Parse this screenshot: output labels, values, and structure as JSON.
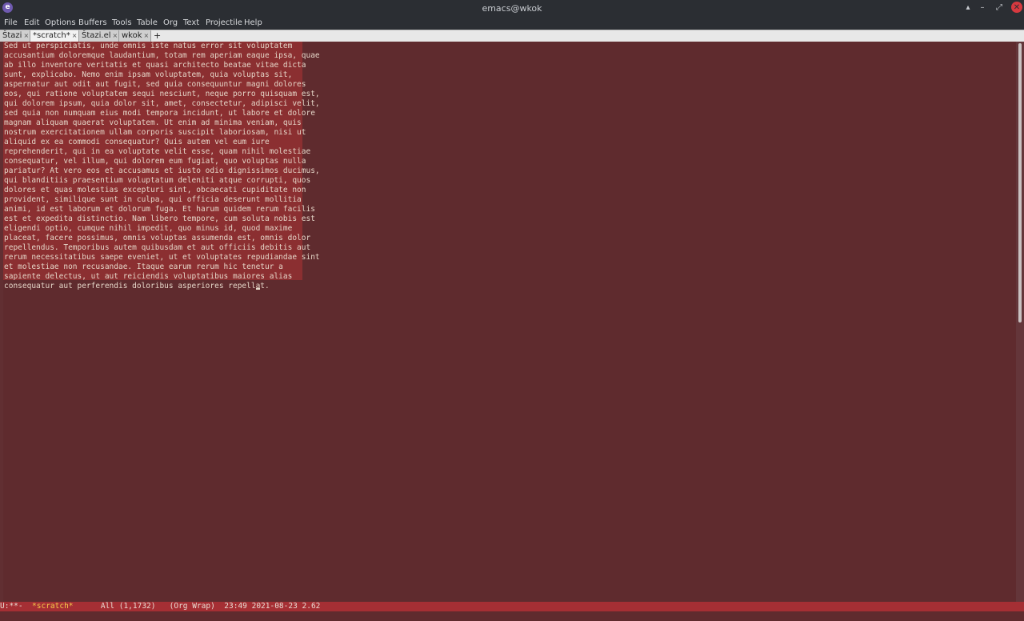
{
  "window": {
    "title": "emacs@wkok",
    "app_icon_letter": "e"
  },
  "window_controls": {
    "up": "▴",
    "minimize": "–",
    "restore": "⤢",
    "close": "✕"
  },
  "menu": [
    "File",
    "Edit",
    "Options",
    "Buffers",
    "Tools",
    "Table",
    "Org",
    "Text",
    "Projectile",
    "Help"
  ],
  "tabs": [
    {
      "label": "Štazi",
      "active": false
    },
    {
      "label": "*scratch*",
      "active": true
    },
    {
      "label": "Štazi.el",
      "active": false
    },
    {
      "label": "wkok",
      "active": false
    }
  ],
  "tab_close": "×",
  "tab_new": "+",
  "buffer": {
    "lines": [
      "Sed ut perspiciatis, unde omnis iste natus error sit voluptatem",
      "accusantium doloremque laudantium, totam rem aperiam eaque ipsa, quae",
      "ab illo inventore veritatis et quasi architecto beatae vitae dicta",
      "sunt, explicabo. Nemo enim ipsam voluptatem, quia voluptas sit,",
      "aspernatur aut odit aut fugit, sed quia consequuntur magni dolores",
      "eos, qui ratione voluptatem sequi nesciunt, neque porro quisquam est,",
      "qui dolorem ipsum, quia dolor sit, amet, consectetur, adipisci velit,",
      "sed quia non numquam eius modi tempora incidunt, ut labore et dolore",
      "magnam aliquam quaerat voluptatem. Ut enim ad minima veniam, quis",
      "nostrum exercitationem ullam corporis suscipit laboriosam, nisi ut",
      "aliquid ex ea commodi consequatur? Quis autem vel eum iure",
      "reprehenderit, qui in ea voluptate velit esse, quam nihil molestiae",
      "consequatur, vel illum, qui dolorem eum fugiat, quo voluptas nulla",
      "pariatur? At vero eos et accusamus et iusto odio dignissimos ducimus,",
      "qui blanditiis praesentium voluptatum deleniti atque corrupti, quos",
      "dolores et quas molestias excepturi sint, obcaecati cupiditate non",
      "provident, similique sunt in culpa, qui officia deserunt mollitia",
      "animi, id est laborum et dolorum fuga. Et harum quidem rerum facilis",
      "est et expedita distinctio. Nam libero tempore, cum soluta nobis est",
      "eligendi optio, cumque nihil impedit, quo minus id, quod maxime",
      "placeat, facere possimus, omnis voluptas assumenda est, omnis dolor",
      "repellendus. Temporibus autem quibusdam et aut officiis debitis aut",
      "rerum necessitatibus saepe eveniet, ut et voluptates repudiandae sint",
      "et molestiae non recusandae. Itaque earum rerum hic tenetur a",
      "sapiente delectus, ut aut reiciendis voluptatibus maiores alias",
      "consequatur aut perferendis doloribus asperiores repellat."
    ]
  },
  "modeline": {
    "status": "U:**-  ",
    "buffer_name": "*scratch*",
    "position": "      All (1,1732)   ",
    "modes": "(Org Wrap)  ",
    "time": "23:49 2021-08-23 2.62"
  },
  "colors": {
    "background": "#5f2b2e",
    "selection": "#8b2f31",
    "modeline": "#a52f34",
    "text": "#e5d6c8",
    "buffer_name": "#f3c94a"
  }
}
